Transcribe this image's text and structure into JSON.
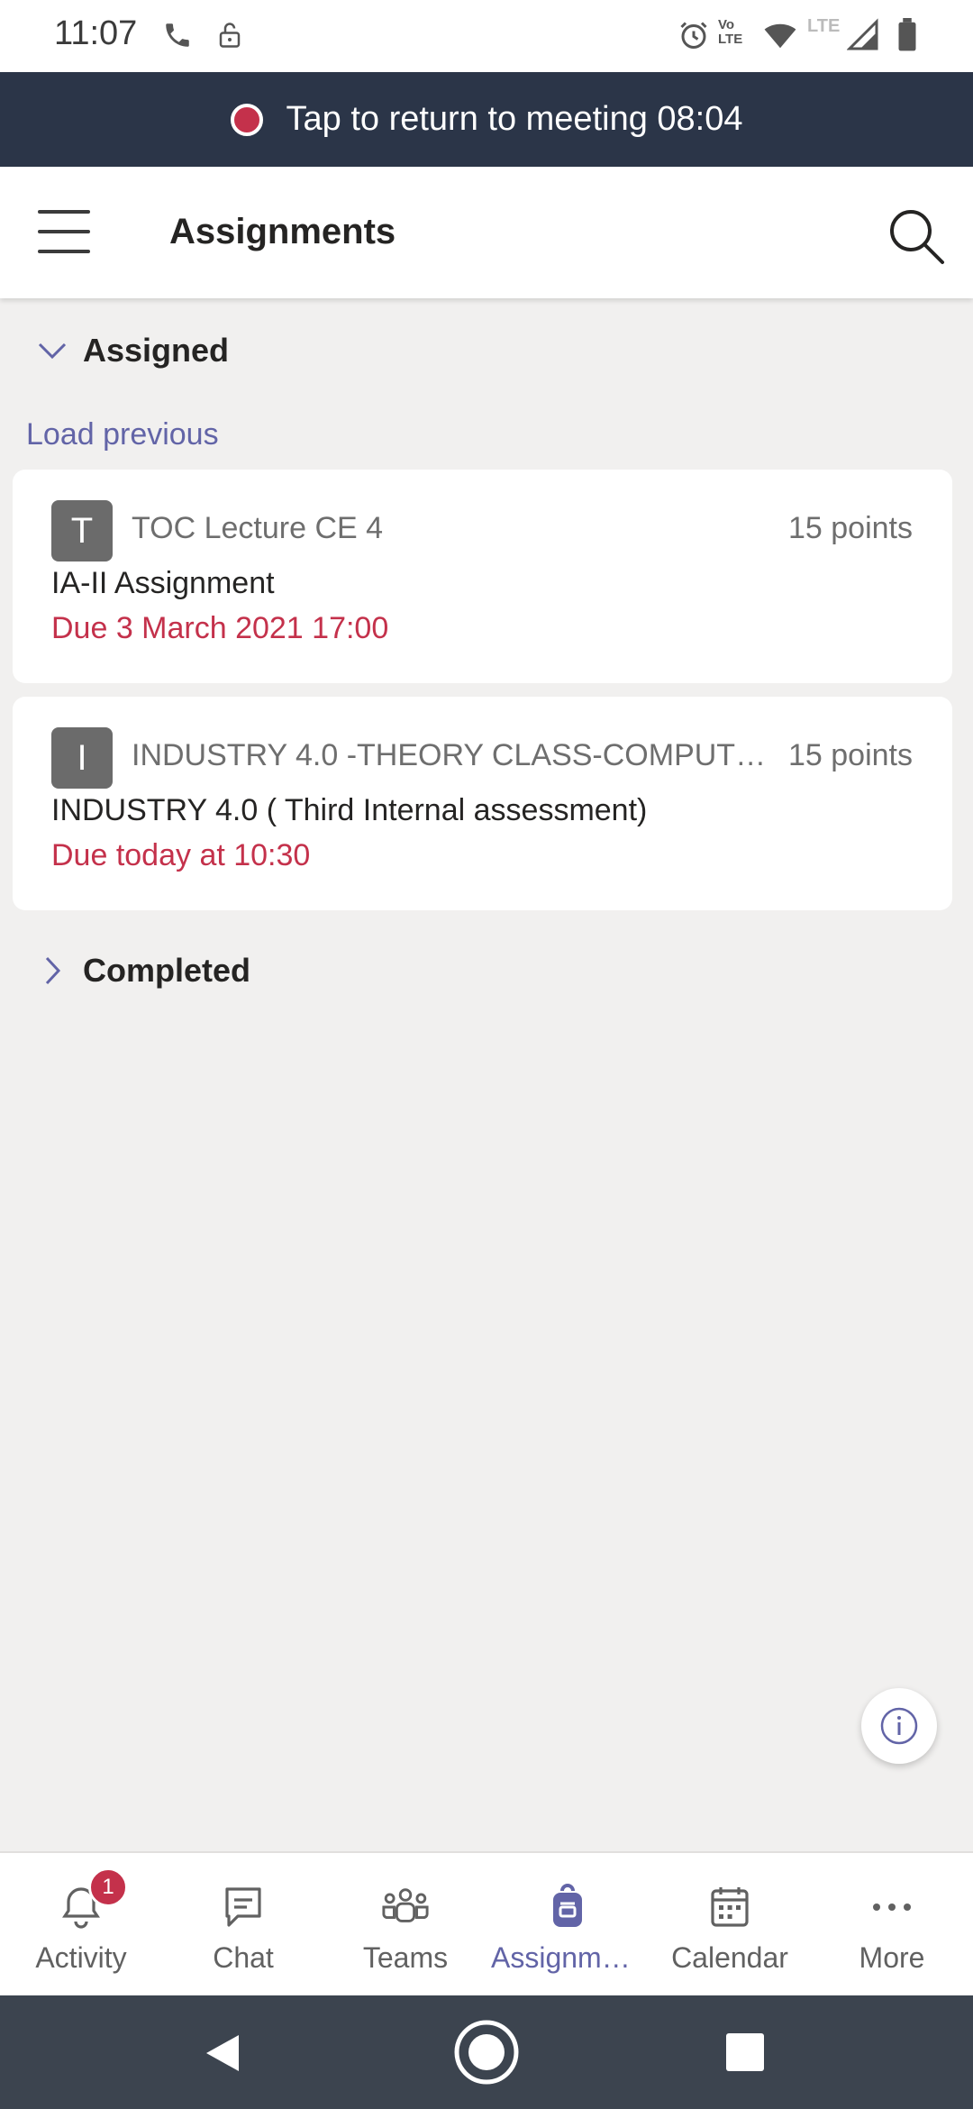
{
  "status_bar": {
    "time": "11:07",
    "icons": [
      "phone-icon",
      "lock-open-icon",
      "alarm-icon",
      "volte-icon",
      "wifi-icon",
      "lte-icon",
      "signal-icon",
      "battery-icon"
    ],
    "volte_label": "Vo LTE",
    "lte_label": "LTE"
  },
  "meeting_banner": {
    "text": "Tap to return to meeting 08:04"
  },
  "app_bar": {
    "title": "Assignments"
  },
  "assigned_section": {
    "title": "Assigned",
    "load_previous": "Load previous",
    "cards": [
      {
        "avatar_letter": "T",
        "class_name": "TOC Lecture CE 4",
        "points": "15 points",
        "title": "IA-II Assignment",
        "due": "Due 3 March 2021 17:00"
      },
      {
        "avatar_letter": "I",
        "class_name": "INDUSTRY 4.0 -THEORY CLASS-COMPUTER ENGINEERING",
        "points": "15 points",
        "title": "INDUSTRY 4.0 ( Third Internal assessment)",
        "due": "Due today at 10:30"
      }
    ]
  },
  "completed_section": {
    "title": "Completed"
  },
  "bottom_nav": {
    "items": [
      {
        "label": "Activity",
        "icon": "bell-icon",
        "badge": "1"
      },
      {
        "label": "Chat",
        "icon": "chat-icon"
      },
      {
        "label": "Teams",
        "icon": "teams-icon"
      },
      {
        "label": "Assignments",
        "icon": "backpack-icon",
        "active": true
      },
      {
        "label": "Calendar",
        "icon": "calendar-icon"
      },
      {
        "label": "More",
        "icon": "more-icon"
      }
    ]
  },
  "colors": {
    "accent": "#6264a7",
    "due": "#c4314b",
    "banner": "#2b3548",
    "background": "#f1f0ef"
  }
}
